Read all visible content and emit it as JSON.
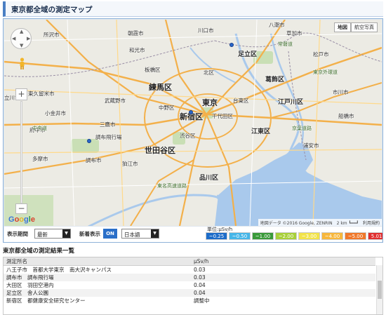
{
  "header": {
    "title": "東京都全域の測定マップ"
  },
  "map": {
    "map_type": {
      "map": "地図",
      "satellite": "航空写真"
    },
    "place_labels": {
      "tokyo": "東京",
      "shinjuku": "新宿区",
      "nerima": "練馬区",
      "adachi": "足立区",
      "setagaya": "世田谷区",
      "katsushika": "葛飾区",
      "edogawa": "江戸川区",
      "koto": "江東区",
      "shinagawa": "品川区",
      "chiyoda": "千代田区",
      "taito": "台東区",
      "kita": "北区",
      "nakano": "中野区",
      "shibuya": "渋谷区",
      "kawaguchi": "川口市",
      "ichikawa": "市川市",
      "funabashi": "船橋市",
      "urayasu": "浦安市",
      "chofu": "調布市",
      "mitaka": "三鷹市",
      "koganei": "小金井市",
      "komae": "狛江市",
      "tama": "多摩市",
      "tokorozawa": "所沢市",
      "asaka": "朝霞市",
      "wako": "和光市",
      "musashino": "武蔵野市",
      "tachikawa": "立川市",
      "fuchu": "府中市",
      "higashikurume": "東久留米市",
      "soka": "草加市",
      "yashio": "八潮市",
      "matsudo": "松戸市",
      "chofu_airport": "調布飛行場",
      "itabashi": "板橋区"
    },
    "roads": {
      "joban": "常磐道",
      "keiyo": "京葉道路",
      "chuo": "中央道",
      "tomei": "東名高速道路",
      "tokyo_gaikan": "東京外環道"
    },
    "google_logo": [
      "G",
      "o",
      "o",
      "g",
      "l",
      "e"
    ],
    "attribution": "地図データ ©2016 Google, ZENRIN　2 km ┗━━┛　利用規約"
  },
  "controls": {
    "period_label": "表示期間",
    "period_value": "最新",
    "newest_label": "新着表示",
    "newest_toggle": "ON",
    "language_value": "日本語",
    "unit_label": "単位:μSv/h",
    "legend": [
      {
        "label": "~0.25",
        "color": "#1d6cc9"
      },
      {
        "label": "~0.50",
        "color": "#47b6e8"
      },
      {
        "label": "~1.00",
        "color": "#3a9a3a"
      },
      {
        "label": "~2.00",
        "color": "#a8d03a"
      },
      {
        "label": "~3.00",
        "color": "#f2e34a"
      },
      {
        "label": "~4.00",
        "color": "#f7b73c"
      },
      {
        "label": "~5.00",
        "color": "#f0782a"
      },
      {
        "label": "5.01~",
        "color": "#e02f2f"
      }
    ]
  },
  "results": {
    "title": "東京都全域の測定結果一覧",
    "columns": [
      "測定所名",
      "μSv/h"
    ],
    "rows": [
      {
        "location": "八王子市　首都大学東京　南大沢キャンパス",
        "value": "0.03"
      },
      {
        "location": "調布市　調布飛行場",
        "value": "0.03"
      },
      {
        "location": "大田区　羽田空港内",
        "value": "0.04"
      },
      {
        "location": "足立区　舎人公園",
        "value": "0.04"
      },
      {
        "location": "新宿区　都健康安全研究センター",
        "value": "調整中"
      }
    ]
  }
}
